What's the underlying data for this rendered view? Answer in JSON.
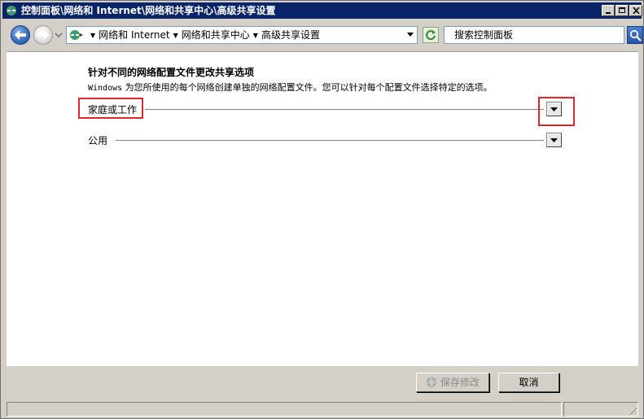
{
  "window": {
    "title": "控制面板\\网络和 Internet\\网络和共享中心\\高级共享设置"
  },
  "navbar": {
    "breadcrumb": [
      "网络和 Internet",
      "网络和共享中心",
      "高级共享设置"
    ],
    "search_placeholder": "搜索控制面板"
  },
  "content": {
    "heading": "针对不同的网络配置文件更改共享选项",
    "description_prefix": "Windows",
    "description_rest": " 为您所使用的每个网络创建单独的网络配置文件。您可以针对每个配置文件选择特定的选项。",
    "profiles": [
      {
        "label": "家庭或工作",
        "highlighted": true
      },
      {
        "label": "公用",
        "highlighted": false
      }
    ],
    "highlight_color": "#e0262c"
  },
  "footer": {
    "save_label": "保存修改",
    "save_enabled": false,
    "cancel_label": "取消"
  },
  "colors": {
    "titlebar": "#0a246a",
    "window_bg": "#d4d0c8",
    "content_bg": "#ffffff"
  }
}
